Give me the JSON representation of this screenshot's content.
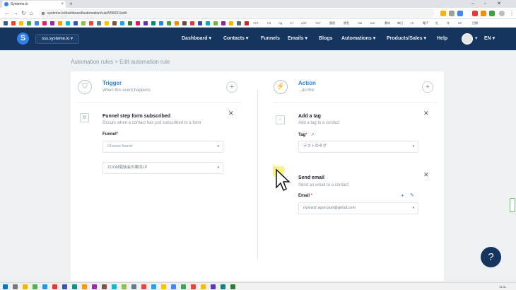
{
  "browser": {
    "tab_title": "Systeme.io",
    "new_tab": "+",
    "url": "systeme.io/dashboard/automation/rule/556031/edit",
    "bookmarks": [
      "SPT",
      "FB",
      "Gg",
      "CT",
      "ASP",
      "TDT",
      "管理",
      "便利",
      "SM",
      "KW",
      "素材",
      "毎日",
      "YS",
      "電子",
      "社",
      "作",
      "NP",
      "目標"
    ]
  },
  "nav": {
    "site": "sss.systeme.io",
    "items": [
      "Dashboard",
      "Contacts",
      "Funnels",
      "Emails",
      "Blogs",
      "Automations",
      "Products/Sales",
      "Help"
    ],
    "lang": "EN"
  },
  "breadcrumb": "Automation rules > Edit automation rule",
  "trigger": {
    "title": "Trigger",
    "subtitle": "When this event happens",
    "block_title": "Funnel step form subscribed",
    "block_sub": "Occurs when a contact has just subscribed to a form",
    "funnel_label": "Funnel",
    "funnel_value": "Choose funnel",
    "step_value": "ZOOM勉強会の案内LP"
  },
  "action": {
    "title": "Action",
    "subtitle": "...do this",
    "tag_title": "Add a tag",
    "tag_sub": "Add a tag to a contact",
    "tag_label": "Tag",
    "tag_value": "テストのタグ",
    "email_title": "Send email",
    "email_sub": "Send an email to a contact",
    "email_label": "Email",
    "email_value": "nyansi2.aguri.puri@gmail.com"
  },
  "help": "?",
  "clock": "11:01",
  "colors": {
    "navy": "#15345e",
    "accent": "#2f80ed",
    "required": "#e23d3d"
  },
  "icons": [
    "shield-icon",
    "lightning-icon",
    "tag-icon",
    "envelope-icon",
    "pencil-icon",
    "plus-icon",
    "close-icon",
    "external-link-icon"
  ]
}
